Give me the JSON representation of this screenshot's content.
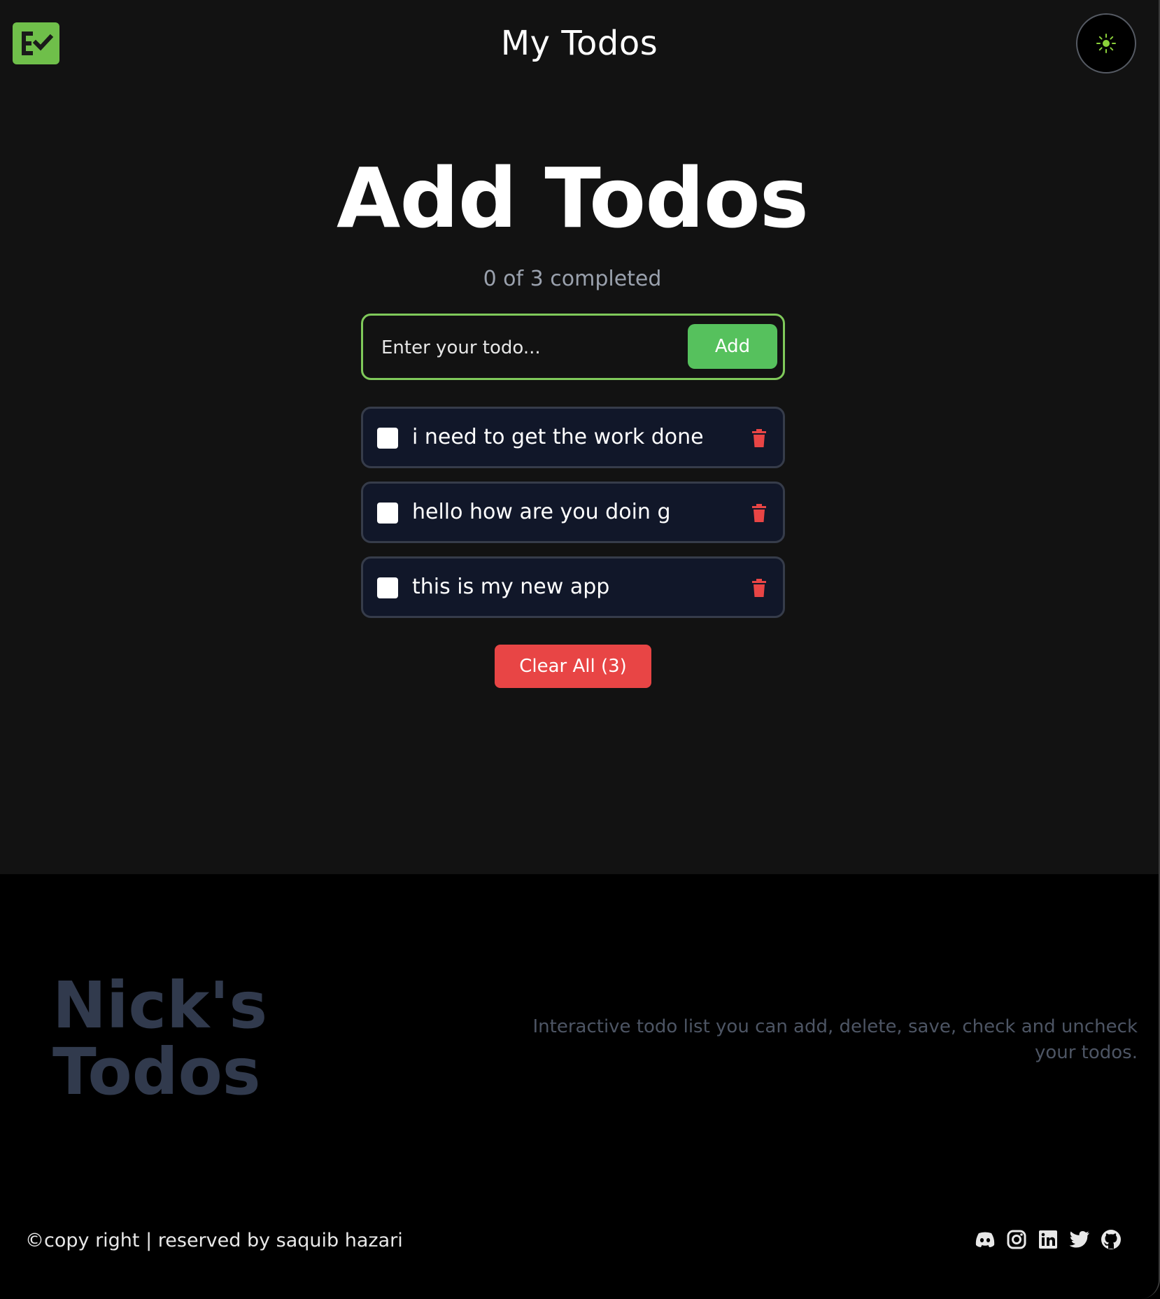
{
  "header": {
    "title": "My Todos",
    "logo_icon": "checklist-icon",
    "theme_toggle_icon": "sun-icon",
    "logo_color": "#6fbf4a",
    "sun_color": "#8bd13a"
  },
  "main": {
    "title": "Add Todos",
    "progress": {
      "text": "0 of 3 completed",
      "completed": 0,
      "total": 3
    },
    "input": {
      "placeholder": "Enter your todo...",
      "value": ""
    },
    "add_label": "Add",
    "todos": [
      {
        "text": "i need to get the work done",
        "checked": false
      },
      {
        "text": "hello how are you doin g",
        "checked": false
      },
      {
        "text": "this is my new app",
        "checked": false
      }
    ],
    "clear_label": "Clear All (3)"
  },
  "footer": {
    "brand_line1": "Nick's",
    "brand_line2": "Todos",
    "description": "Interactive todo list you can add, delete, save, check and uncheck your todos.",
    "copyright": "©copy right | reserved by saquib hazari",
    "socials": [
      "discord-icon",
      "instagram-icon",
      "linkedin-icon",
      "twitter-icon",
      "github-icon"
    ]
  },
  "colors": {
    "accent_green": "#56c15d",
    "input_border": "#7fc95a",
    "danger_red": "#e84545",
    "todo_bg": "#111729",
    "footer_brand": "#313a4d"
  }
}
